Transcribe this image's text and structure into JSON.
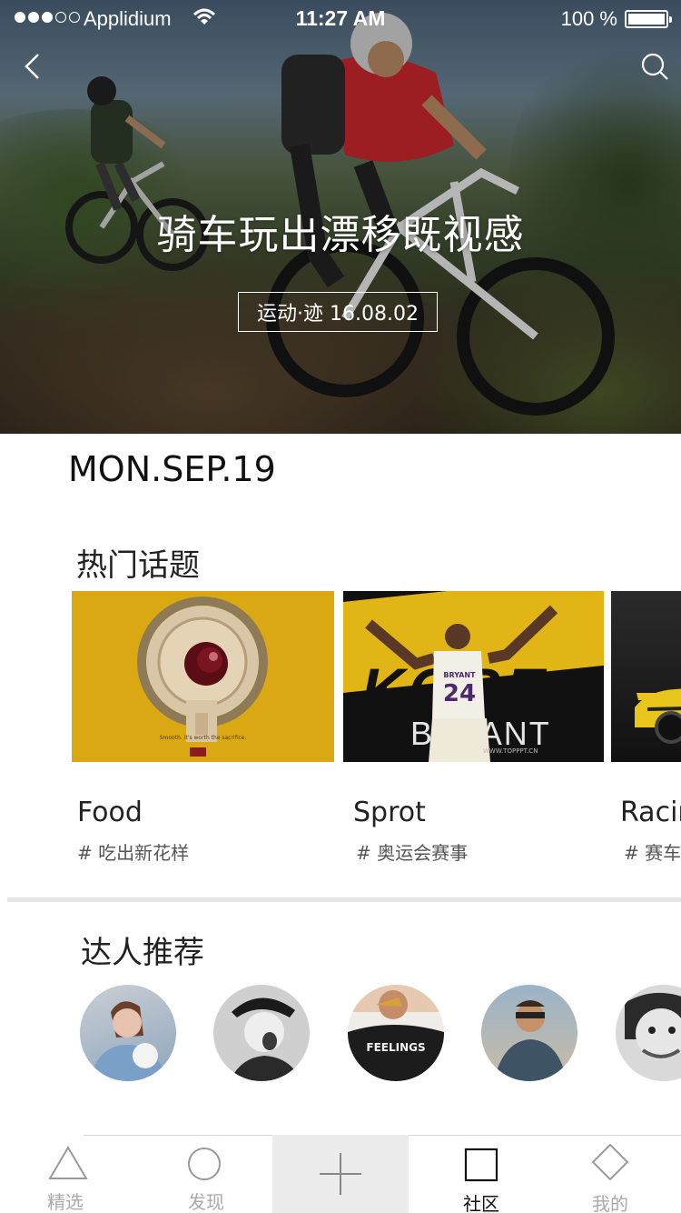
{
  "status_bar": {
    "carrier": "Applidium",
    "time": "11:27 AM",
    "battery_text": "100 %"
  },
  "hero": {
    "title": "骑车玩出漂移既视感",
    "tag": "运动·迹 16.08.02"
  },
  "date": "MON.SEP.19",
  "topics": {
    "title": "热门话题",
    "items": [
      {
        "name": "Food",
        "tag": "# 吃出新花样"
      },
      {
        "name": "Sprot",
        "tag": "# 奥运会赛事"
      },
      {
        "name": "Racing",
        "tag": "# 赛车"
      }
    ],
    "poster_text": {
      "food_caption": "Smooth. It's worth the sacrifice.",
      "kobe_big": "KOBE",
      "kobe_sub": "BRYANT",
      "kobe_site": "WWW.TOPPPT.CN",
      "jersey_name": "BRYANT",
      "jersey_number": "24"
    }
  },
  "experts": {
    "title": "达人推荐",
    "shirt_text": "FEELINGS"
  },
  "tabbar": {
    "tabs": [
      {
        "label": "精选",
        "icon": "triangle-icon"
      },
      {
        "label": "发现",
        "icon": "circle-icon"
      },
      {
        "label": "",
        "icon": "plus-icon"
      },
      {
        "label": "社区",
        "icon": "square-icon"
      },
      {
        "label": "我的",
        "icon": "diamond-icon"
      }
    ]
  },
  "colors": {
    "accent_yellow": "#d9a812",
    "tab_active": "#111111",
    "tab_inactive": "#aaaaaa"
  }
}
